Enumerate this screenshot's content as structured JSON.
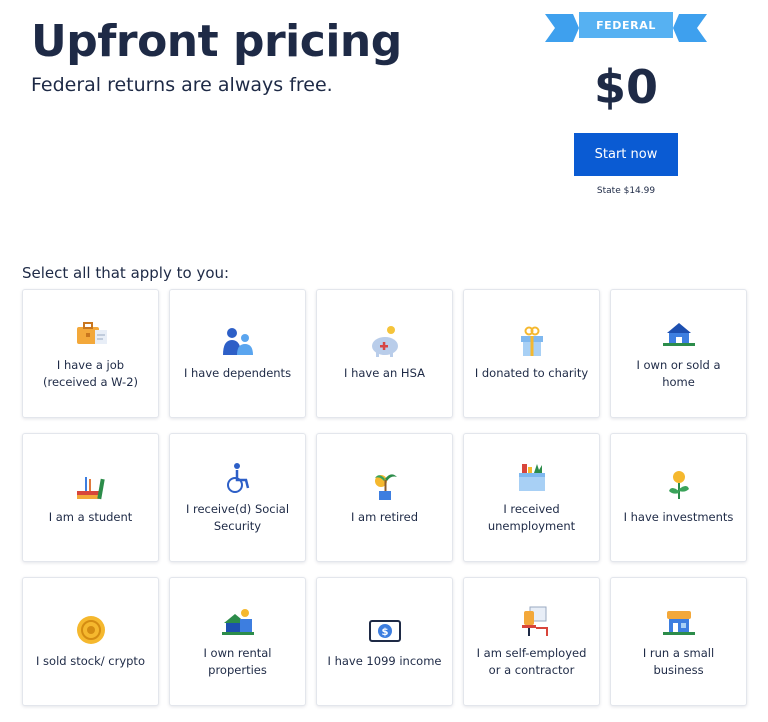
{
  "header": {
    "title": "Upfront pricing",
    "subtitle": "Federal returns are always free."
  },
  "pricing": {
    "ribbon": "FEDERAL",
    "price": "$0",
    "cta": "Start now",
    "state_note": "State $14.99"
  },
  "prompt": "Select all that apply to you:",
  "options": [
    {
      "label": "I have a job (received a W-2)",
      "icon": "briefcase-icon"
    },
    {
      "label": "I have dependents",
      "icon": "family-icon"
    },
    {
      "label": "I have an HSA",
      "icon": "piggy-bank-icon"
    },
    {
      "label": "I donated to charity",
      "icon": "gift-box-icon"
    },
    {
      "label": "I own or sold a home",
      "icon": "house-icon"
    },
    {
      "label": "I am a student",
      "icon": "books-icon"
    },
    {
      "label": "I receive(d) Social Security",
      "icon": "wheelchair-icon"
    },
    {
      "label": "I am retired",
      "icon": "palm-tree-icon"
    },
    {
      "label": "I received unemployment",
      "icon": "box-icon"
    },
    {
      "label": "I have investments",
      "icon": "plant-coin-icon"
    },
    {
      "label": "I sold stock/ crypto",
      "icon": "coin-icon"
    },
    {
      "label": "I own rental properties",
      "icon": "rental-house-icon"
    },
    {
      "label": "I have 1099 income",
      "icon": "cash-icon"
    },
    {
      "label": "I am self-employed or a contractor",
      "icon": "desk-chair-icon"
    },
    {
      "label": "I run a small business",
      "icon": "storefront-icon"
    }
  ],
  "colors": {
    "accent": "#0a5bd3",
    "ribbon": "#3ea0ee",
    "text": "#1e2a46"
  }
}
